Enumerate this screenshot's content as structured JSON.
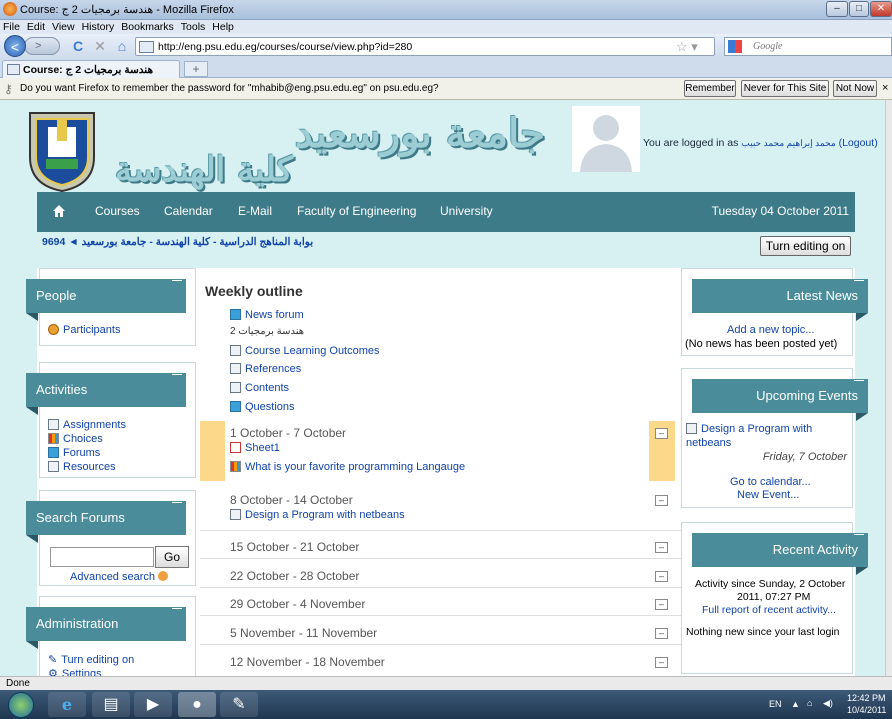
{
  "window": {
    "title": "Course: هندسة برمجيات 2 ج - Mozilla Firefox",
    "min": "–",
    "max": "□",
    "close": "✕"
  },
  "menu": [
    "File",
    "Edit",
    "View",
    "History",
    "Bookmarks",
    "Tools",
    "Help"
  ],
  "nav": {
    "url": "http://eng.psu.edu.eg/courses/course/view.php?id=280",
    "search_placeholder": "Google",
    "back": "<",
    "forward": ">",
    "reload": "C",
    "stop": "✕",
    "home": "⌂"
  },
  "tab": {
    "label": "Course: هندسة برمجيات 2 ج",
    "new": "+"
  },
  "password_bar": {
    "message": "Do you want Firefox to remember the password for \"mhabib@eng.psu.edu.eg\" on psu.edu.eg?",
    "remember": "Remember",
    "never": "Never for This Site",
    "not_now": "Not Now"
  },
  "header": {
    "title_line1": "جامعة بورسعيد",
    "title_line2": "كلية الهندسة",
    "logged_in_prefix": "You are logged in as",
    "user_name": "محمد إبراهيم محمد حبيب",
    "logout": "(Logout)"
  },
  "main_nav": {
    "items": [
      "Courses",
      "Calendar",
      "E-Mail",
      "Faculty of Engineering",
      "University"
    ],
    "date": "Tuesday 04 October 2011"
  },
  "breadcrumb": {
    "text": "بوابة المناهج الدراسية - كلية الهندسة - جامعة بورسعيد ◄ 9694",
    "edit_button": "Turn editing on"
  },
  "left": {
    "people": {
      "title": "People",
      "items": [
        "Participants"
      ]
    },
    "activities": {
      "title": "Activities",
      "items": [
        "Assignments",
        "Choices",
        "Forums",
        "Resources"
      ]
    },
    "search": {
      "title": "Search Forums",
      "go": "Go",
      "advanced": "Advanced search"
    },
    "admin": {
      "title": "Administration",
      "items": [
        "Turn editing on",
        "Settings"
      ]
    }
  },
  "center": {
    "title": "Weekly outline",
    "intro_items": [
      "News forum",
      "هندسة برمجيات 2",
      "Course Learning Outcomes",
      "References",
      "Contents",
      "Questions"
    ],
    "weeks": [
      {
        "title": "1 October - 7 October",
        "items": [
          "Sheet1",
          "What is your favorite programming Langauge"
        ]
      },
      {
        "title": "8 October - 14 October",
        "items": [
          "Design a Program with netbeans"
        ]
      },
      {
        "title": "15 October - 21 October",
        "items": []
      },
      {
        "title": "22 October - 28 October",
        "items": []
      },
      {
        "title": "29 October - 4 November",
        "items": []
      },
      {
        "title": "5 November - 11 November",
        "items": []
      },
      {
        "title": "12 November - 18 November",
        "items": []
      }
    ],
    "collapse_symbol": "–"
  },
  "right": {
    "news": {
      "title": "Latest News",
      "add": "Add a new topic...",
      "empty": "(No news has been posted yet)"
    },
    "events": {
      "title": "Upcoming Events",
      "event_line1": "Design a Program with",
      "event_line2": "netbeans",
      "event_date": "Friday, 7 October",
      "calendar": "Go to calendar...",
      "new_event": "New Event..."
    },
    "activity": {
      "title": "Recent Activity",
      "since_line1": "Activity since Sunday, 2 October",
      "since_line2": "2011, 07:27 PM",
      "full_report": "Full report of recent activity...",
      "nothing": "Nothing new since your last login"
    }
  },
  "status": "Done",
  "tray": {
    "lang": "EN",
    "time": "12:42 PM",
    "date": "10/4/2011"
  }
}
